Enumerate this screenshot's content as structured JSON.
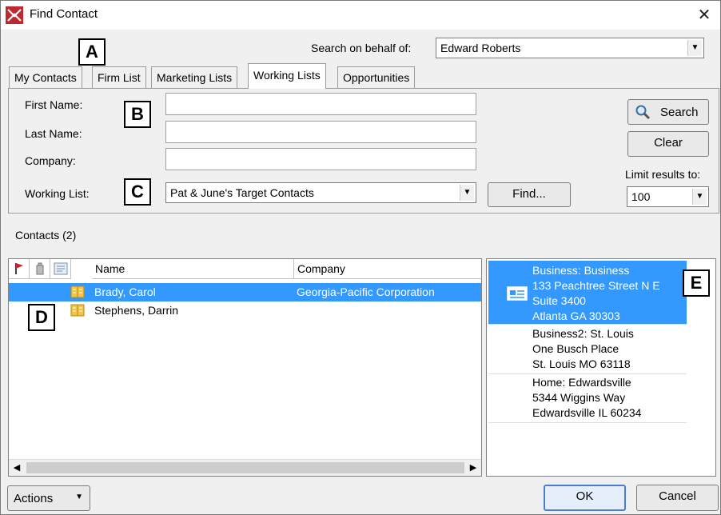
{
  "window": {
    "title": "Find Contact"
  },
  "header": {
    "behalf_label": "Search on behalf of:",
    "behalf_value": "Edward Roberts"
  },
  "tabs": [
    "My Contacts",
    "Firm List",
    "Marketing Lists",
    "Working Lists",
    "Opportunities"
  ],
  "active_tab": "Working Lists",
  "form": {
    "first_name_label": "First Name:",
    "last_name_label": "Last Name:",
    "company_label": "Company:",
    "working_list_label": "Working List:",
    "first_name_value": "",
    "last_name_value": "",
    "company_value": "",
    "working_list_value": "Pat & June's Target Contacts",
    "find_button": "Find...",
    "search_button": "Search",
    "clear_button": "Clear",
    "limit_label": "Limit results to:",
    "limit_value": "100"
  },
  "contacts": {
    "heading": "Contacts (2)",
    "columns": {
      "name": "Name",
      "company": "Company"
    },
    "rows": [
      {
        "name": "Brady, Carol",
        "company": "Georgia-Pacific Corporation",
        "selected": true
      },
      {
        "name": "Stephens, Darrin",
        "company": "",
        "selected": false
      }
    ]
  },
  "addresses": [
    {
      "lines": [
        "Business:  Business",
        "133 Peachtree Street N E",
        "Suite 3400",
        "Atlanta GA 30303"
      ],
      "selected": true
    },
    {
      "lines": [
        "Business2:  St. Louis",
        "One Busch Place",
        "St. Louis MO 63118"
      ],
      "selected": false
    },
    {
      "lines": [
        "Home:  Edwardsville",
        "5344 Wiggins Way",
        "Edwardsville IL 60234"
      ],
      "selected": false
    }
  ],
  "callouts": {
    "a": "A",
    "b": "B",
    "c": "C",
    "d": "D",
    "e": "E"
  },
  "footer": {
    "actions_button": "Actions",
    "ok_button": "OK",
    "cancel_button": "Cancel"
  },
  "colors": {
    "selection": "#3399ff",
    "accent_border": "#4a7cd0",
    "app_icon": "#c0282d"
  },
  "icons": {
    "app": "app-logo-icon",
    "close": "close-icon",
    "flag": "flag-icon",
    "building": "building-icon",
    "card": "card-icon",
    "contact": "contact-card-icon",
    "address": "address-card-icon",
    "magnifier": "magnifier-icon"
  }
}
